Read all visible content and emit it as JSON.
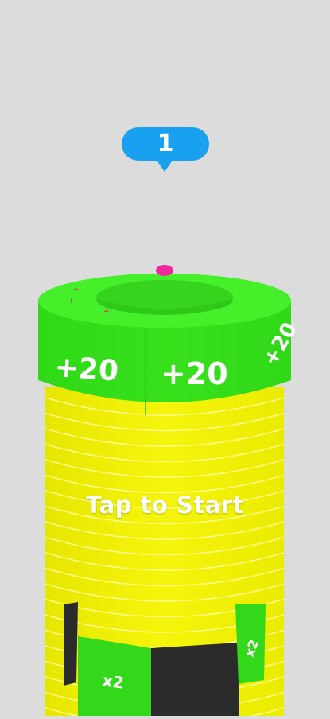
{
  "level": {
    "number": "1",
    "bubble_color": "#1aa0f0"
  },
  "prompt": {
    "start_text": "Tap to Start"
  },
  "top_ring": {
    "color": "#33e01a",
    "labels": [
      "+20",
      "+20",
      "+20"
    ]
  },
  "bottom_ring": {
    "color": "#33e01a",
    "labels": [
      "x2",
      "x2"
    ]
  },
  "colors": {
    "background": "#dcdcdc",
    "stack": "#f2f20a",
    "ball": "#ee2a9a",
    "dark_segment": "#2b2b2b"
  }
}
